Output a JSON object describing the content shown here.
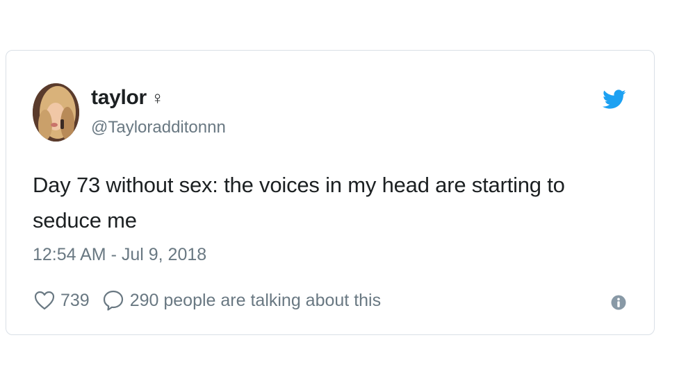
{
  "tweet": {
    "author_name": "taylor",
    "author_emoji": "♀",
    "author_handle": "@Tayloradditonnn",
    "text": "Day 73 without sex: the voices in my head are starting to seduce me",
    "timestamp": "12:54 AM - Jul 9, 2018",
    "like_count": "739",
    "reply_text": "290 people are talking about this",
    "icons": {
      "brand": "twitter-bird-icon",
      "like": "heart-icon",
      "reply": "speech-bubble-icon",
      "info": "info-icon"
    },
    "colors": {
      "brand": "#1da1f2",
      "muted": "#697882",
      "text": "#1c2022",
      "border": "#d9dfe6"
    }
  }
}
